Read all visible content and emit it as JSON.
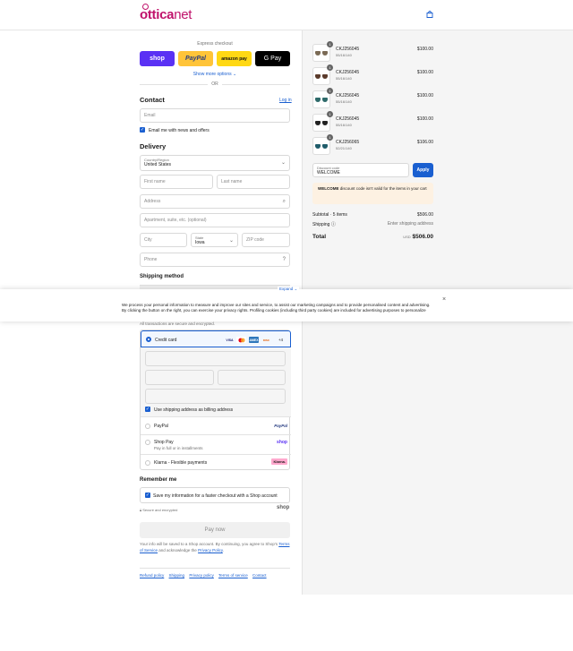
{
  "header": {
    "logo_prefix": "ottica",
    "logo_suffix": "net"
  },
  "express": {
    "title": "Express checkout",
    "shop_label": "shop",
    "paypal_label": "PayPal",
    "amazon_label": "amazon pay",
    "gpay_label": "G Pay",
    "show_more": "Show more options ⌄",
    "or": "OR"
  },
  "contact": {
    "heading": "Contact",
    "login": "Log in",
    "email_placeholder": "Email",
    "news_label": "Email me with news and offers"
  },
  "delivery": {
    "heading": "Delivery",
    "country_label": "Country/Region",
    "country_value": "United States",
    "first_name": "First name",
    "last_name": "Last name",
    "address": "Address",
    "apartment": "Apartment, suite, etc. (optional)",
    "city": "City",
    "state_label": "State",
    "state_value": "Iowa",
    "zip": "ZIP code",
    "phone": "Phone"
  },
  "shipping_method": {
    "heading": "Shipping method"
  },
  "cookie": {
    "expand": "Expand ⌄",
    "text": "We process your personal information to measure and improve our sites and service, to assist our marketing campaigns and to provide personalised content and advertising. By clicking the button on the right, you can exercise your privacy rights. Profiling cookies (including third party cookies) are included for advertising purposes to personalize"
  },
  "payment": {
    "secured_note": "All transactions are secure and encrypted.",
    "credit_card": "Credit card",
    "card_brands": [
      "VISA",
      "MC",
      "AMEX",
      "DISC",
      "+4"
    ],
    "billing_label": "Use shipping address as billing address",
    "paypal": "PayPal",
    "paypal_brand": "PayPal",
    "shop_pay": "Shop Pay",
    "shop_pay_sub": "Pay in full or in installments",
    "shop_brand": "shop",
    "klarna": "Klarna - Flexible payments",
    "klarna_brand": "Klarna."
  },
  "remember": {
    "heading": "Remember me",
    "label": "Save my information for a faster checkout with a Shop account",
    "secure": "Secure and encrypted",
    "shop_brand": "shop"
  },
  "pay_now": "Pay now",
  "legal": {
    "text_before": "Your info will be saved to a Shop account. By continuing, you agree to Shop's",
    "terms": "Terms of Service",
    "text_mid": "and acknowledge the",
    "privacy": "Privacy Policy",
    "text_end": "."
  },
  "footer": {
    "links": [
      "Refund policy",
      "Shipping",
      "Privacy policy",
      "Terms of service",
      "Contact"
    ]
  },
  "cart": {
    "items": [
      {
        "qty": "1",
        "name": "CKJ256045",
        "variant": "55/16/140",
        "price": "$100.00",
        "lens": "#7a6a55"
      },
      {
        "qty": "1",
        "name": "CKJ256045",
        "variant": "55/16/140",
        "price": "$100.00",
        "lens": "#5a3a2a"
      },
      {
        "qty": "1",
        "name": "CKJ256045",
        "variant": "55/16/140",
        "price": "$100.00",
        "lens": "#2e6a6a"
      },
      {
        "qty": "1",
        "name": "CKJ256045",
        "variant": "55/16/140",
        "price": "$100.00",
        "lens": "#222222"
      },
      {
        "qty": "1",
        "name": "CKJ256065",
        "variant": "52/21/140",
        "price": "$106.00",
        "lens": "#1f5c6a"
      }
    ],
    "discount_label": "Discount code",
    "discount_value": "WELCOME",
    "apply": "Apply",
    "warning_code": "WELCOME",
    "warning_text": "discount code isn't valid for the items in your cart",
    "subtotal_label": "Subtotal · 5 items",
    "subtotal_value": "$506.00",
    "shipping_label": "Shipping ⓘ",
    "shipping_value": "Enter shipping address",
    "total_label": "Total",
    "currency": "USD",
    "total_value": "$506.00"
  }
}
